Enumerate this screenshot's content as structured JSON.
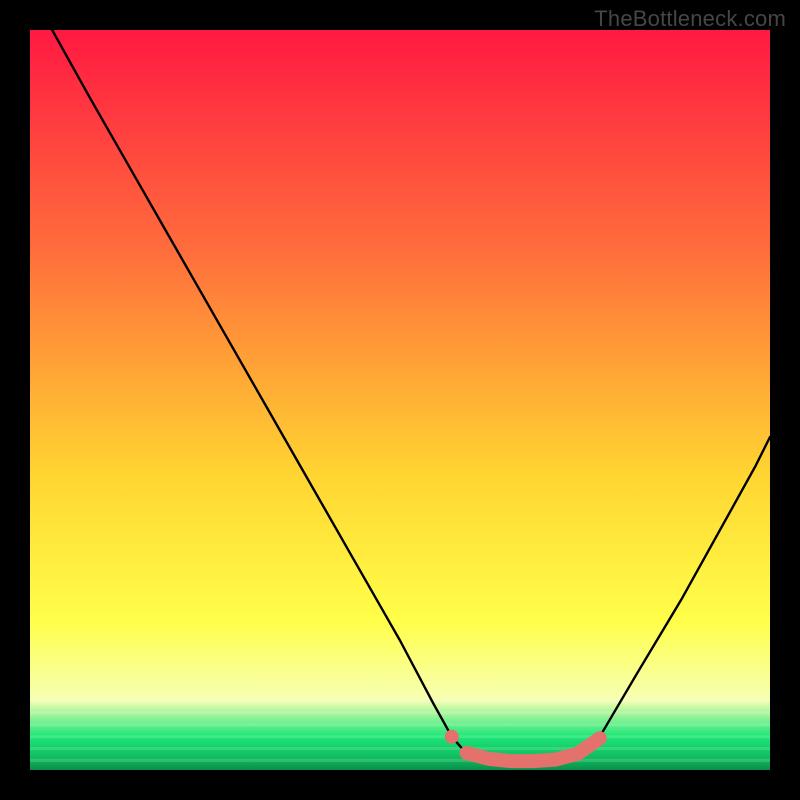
{
  "watermark": "TheBottleneck.com",
  "colors": {
    "top": "#FF1942",
    "mid1": "#FF6E3C",
    "mid2": "#FFD531",
    "mid3": "#FFFF4A",
    "pale": "#F6FFB3",
    "green": "#1CE677",
    "black": "#000000",
    "marker": "#E4716B"
  },
  "chart_data": {
    "type": "line",
    "title": "",
    "xlabel": "",
    "ylabel": "",
    "xlim": [
      0,
      100
    ],
    "ylim": [
      0,
      100
    ],
    "curve_x": [
      3,
      8,
      14,
      20,
      26,
      32,
      38,
      44,
      50,
      54.5,
      57,
      59,
      62,
      66,
      70,
      73,
      77,
      82,
      88,
      93,
      98,
      100
    ],
    "curve_y": [
      100,
      91,
      80.5,
      70,
      59.5,
      49,
      38.5,
      28,
      17.5,
      9,
      4.5,
      2.2,
      1.2,
      1.0,
      1.0,
      1.3,
      4.5,
      13,
      23,
      32,
      41,
      45
    ],
    "marker_start": {
      "x": 57,
      "y": 4.5
    },
    "marker_band": [
      {
        "x": 59,
        "y": 2.3
      },
      {
        "x": 62,
        "y": 1.5
      },
      {
        "x": 65,
        "y": 1.2
      },
      {
        "x": 68,
        "y": 1.2
      },
      {
        "x": 71,
        "y": 1.4
      },
      {
        "x": 74,
        "y": 2.2
      },
      {
        "x": 77,
        "y": 4.3
      }
    ]
  }
}
